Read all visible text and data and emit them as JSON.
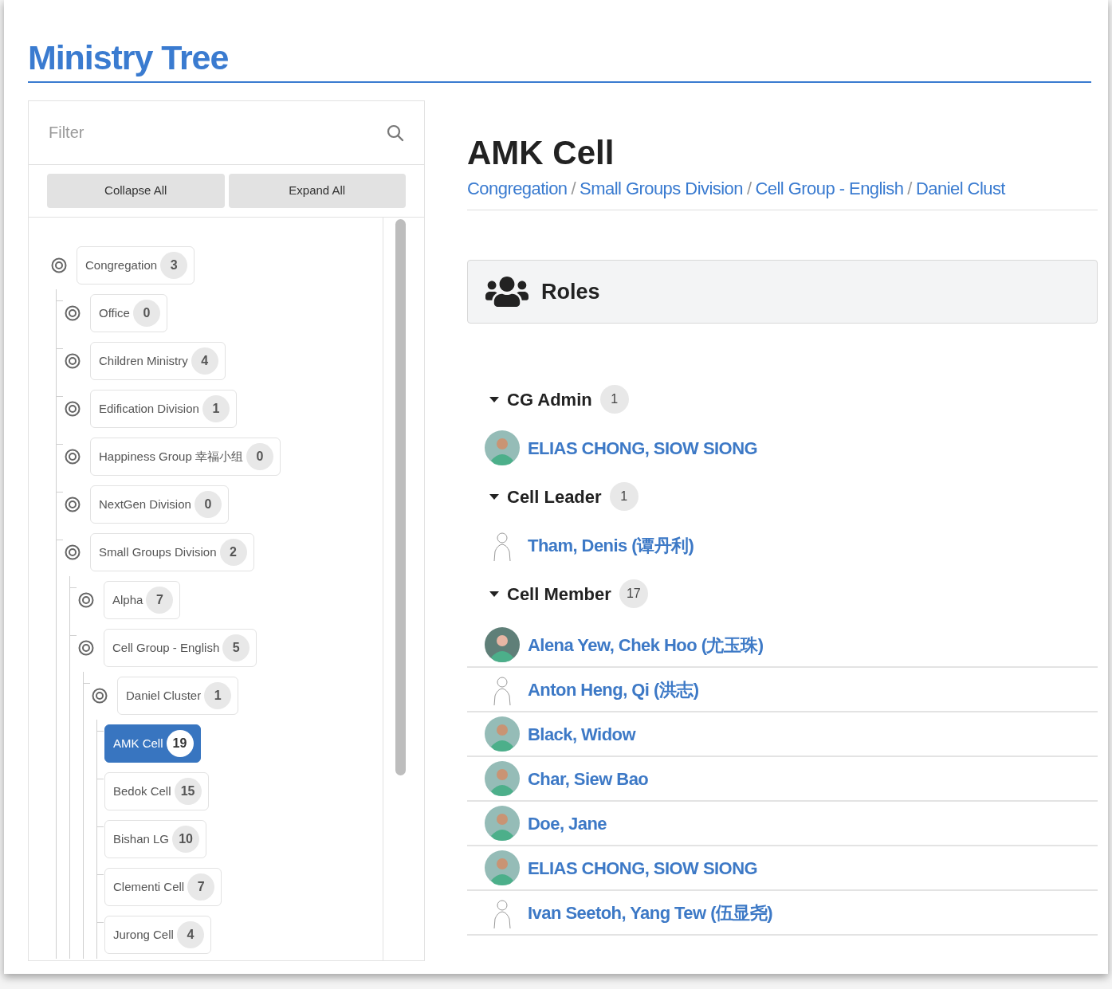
{
  "page_title": "Ministry Tree",
  "sidebar": {
    "filter": {
      "placeholder": "Filter"
    },
    "buttons": [
      "Collapse All",
      "Expand All"
    ],
    "tree": [
      {
        "label": "Congregation",
        "count": "3",
        "expandable": true,
        "selected": false,
        "children": [
          {
            "label": "Office",
            "count": "0",
            "expandable": true,
            "selected": false
          },
          {
            "label": "Children Ministry",
            "count": "4",
            "expandable": true,
            "selected": false
          },
          {
            "label": "Edification Division",
            "count": "1",
            "expandable": true,
            "selected": false
          },
          {
            "label": "Happiness Group 幸福小组",
            "count": "0",
            "expandable": true,
            "selected": false
          },
          {
            "label": "NextGen Division",
            "count": "0",
            "expandable": true,
            "selected": false
          },
          {
            "label": "Small Groups Division",
            "count": "2",
            "expandable": true,
            "selected": false,
            "children": [
              {
                "label": "Alpha",
                "count": "7",
                "expandable": true,
                "selected": false
              },
              {
                "label": "Cell Group - English",
                "count": "5",
                "expandable": true,
                "selected": false,
                "children": [
                  {
                    "label": "Daniel Cluster",
                    "count": "1",
                    "expandable": true,
                    "selected": false,
                    "children": [
                      {
                        "label": "AMK Cell",
                        "count": "19",
                        "expandable": false,
                        "selected": true
                      },
                      {
                        "label": "Bedok Cell",
                        "count": "15",
                        "expandable": false,
                        "selected": false
                      },
                      {
                        "label": "Bishan LG",
                        "count": "10",
                        "expandable": false,
                        "selected": false
                      },
                      {
                        "label": "Clementi Cell",
                        "count": "7",
                        "expandable": false,
                        "selected": false
                      },
                      {
                        "label": "Jurong Cell",
                        "count": "4",
                        "expandable": false,
                        "selected": false
                      }
                    ]
                  }
                ]
              }
            ]
          }
        ]
      }
    ]
  },
  "detail": {
    "title": "AMK Cell",
    "breadcrumb": [
      {
        "kind": "link",
        "text": "Congregation"
      },
      {
        "kind": "separator",
        "text": "/"
      },
      {
        "kind": "link",
        "text": "Small Groups Division"
      },
      {
        "kind": "separator",
        "text": "/"
      },
      {
        "kind": "link",
        "text": "Cell Group - English"
      },
      {
        "kind": "separator",
        "text": "/"
      },
      {
        "kind": "link",
        "text": "Daniel Clust"
      }
    ],
    "roles_panel": {
      "title": "Roles"
    },
    "groups": [
      {
        "title": "CG Admin",
        "count": "1",
        "expanded": true,
        "members": [
          {
            "name": "ELIAS CHONG, SIOW SIONG",
            "kind": "man"
          }
        ]
      },
      {
        "title": "Cell Leader",
        "count": "1",
        "expanded": true,
        "members": [
          {
            "name": "Tham, Denis (谭丹利)",
            "kind": "sketch"
          }
        ]
      },
      {
        "title": "Cell Member",
        "count": "17",
        "expanded": true,
        "members": [
          {
            "name": "Alena Yew, Chek Hoo (尤玉珠)",
            "kind": "woman"
          },
          {
            "name": "Anton Heng, Qi (洪志)",
            "kind": "sketch"
          },
          {
            "name": "Black, Widow",
            "kind": "man"
          },
          {
            "name": "Char, Siew Bao",
            "kind": "man"
          },
          {
            "name": "Doe, Jane",
            "kind": "man"
          },
          {
            "name": "ELIAS CHONG, SIOW SIONG",
            "kind": "man"
          },
          {
            "name": "Ivan Seetoh, Yang Tew (伍显尧)",
            "kind": "sketch"
          }
        ]
      }
    ]
  }
}
